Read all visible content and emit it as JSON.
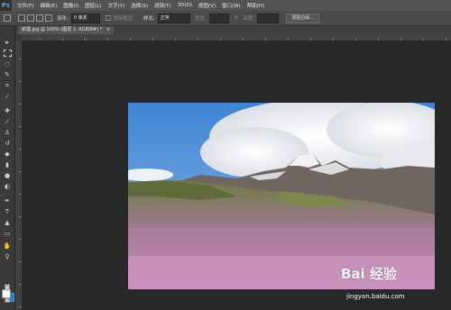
{
  "app": {
    "logo": "Ps"
  },
  "menu": [
    "文件(F)",
    "编辑(E)",
    "图像(I)",
    "图层(L)",
    "文字(Y)",
    "选择(S)",
    "滤镜(T)",
    "3D(D)",
    "视图(V)",
    "窗口(W)",
    "帮助(H)"
  ],
  "options_bar": {
    "feather_label": "羽化:",
    "feather_value": "0 像素",
    "antialias_label": "消除锯齿",
    "style_label": "样式:",
    "style_value": "正常",
    "width_label": "宽度:",
    "height_label": "高度:",
    "refine_edge_button": "调整边缘..."
  },
  "document_tab": {
    "label": "新疆.jpg @ 100% (图层 1, RGB/8#) *",
    "close": "×"
  },
  "colors": {
    "accent": "#1f7fd0",
    "sky": "#4a8fd6"
  },
  "watermark": {
    "brand": "Bai 经验",
    "url": "jingyan.baidu.com"
  }
}
